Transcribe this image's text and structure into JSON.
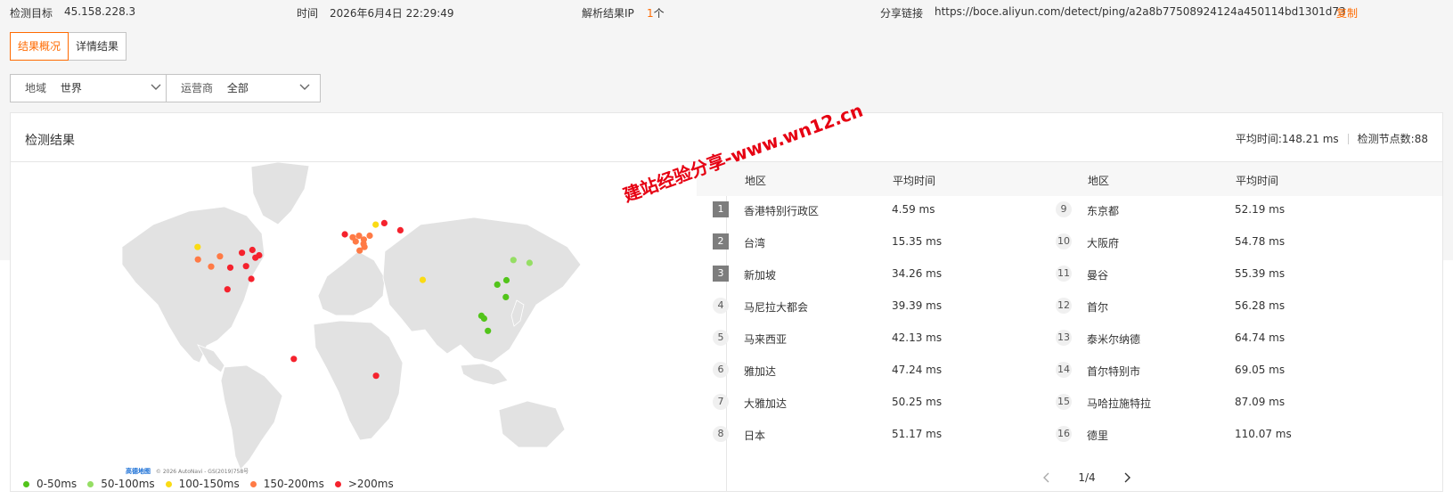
{
  "infobar": {
    "target_label": "检测目标",
    "target_value": "45.158.228.3",
    "time_label": "时间",
    "time_value": "2026年6月4日 22:29:49",
    "resolve_label": "解析结果IP",
    "resolve_count": "1",
    "resolve_unit": "个",
    "share_label": "分享链接",
    "share_url": "https://boce.aliyun.com/detect/ping/a2a8b77508924124a450114bd1301d73",
    "copy_label": "复制"
  },
  "tabs": [
    {
      "label": "结果概况",
      "active": true
    },
    {
      "label": "详情结果",
      "active": false
    }
  ],
  "filters": {
    "region_label": "地域",
    "region_value": "世界",
    "isp_label": "运营商",
    "isp_value": "全部"
  },
  "panel": {
    "title": "检测结果",
    "avg_time": "平均时间:148.21 ms",
    "node_count": "检测节点数:88"
  },
  "table": {
    "col_region": "地区",
    "col_avg": "平均时间",
    "left_rows": [
      {
        "rank": "1",
        "region": "香港特别行政区",
        "avg": "4.59 ms"
      },
      {
        "rank": "2",
        "region": "台湾",
        "avg": "15.35 ms"
      },
      {
        "rank": "3",
        "region": "新加坡",
        "avg": "34.26 ms"
      },
      {
        "rank": "4",
        "region": "马尼拉大都会",
        "avg": "39.39 ms"
      },
      {
        "rank": "5",
        "region": "马来西亚",
        "avg": "42.13 ms"
      },
      {
        "rank": "6",
        "region": "雅加达",
        "avg": "47.24 ms"
      },
      {
        "rank": "7",
        "region": "大雅加达",
        "avg": "50.25 ms"
      },
      {
        "rank": "8",
        "region": "日本",
        "avg": "51.17 ms"
      }
    ],
    "right_rows": [
      {
        "rank": "9",
        "region": "东京都",
        "avg": "52.19 ms"
      },
      {
        "rank": "10",
        "region": "大阪府",
        "avg": "54.78 ms"
      },
      {
        "rank": "11",
        "region": "曼谷",
        "avg": "55.39 ms"
      },
      {
        "rank": "12",
        "region": "首尔",
        "avg": "56.28 ms"
      },
      {
        "rank": "13",
        "region": "泰米尔纳德",
        "avg": "64.74 ms"
      },
      {
        "rank": "14",
        "region": "首尔特别市",
        "avg": "69.05 ms"
      },
      {
        "rank": "15",
        "region": "马哈拉施特拉",
        "avg": "87.09 ms"
      },
      {
        "rank": "16",
        "region": "德里",
        "avg": "110.07 ms"
      }
    ]
  },
  "pager": {
    "text": "1/4"
  },
  "legend": [
    {
      "label": "0-50ms",
      "color": "#52c41a"
    },
    {
      "label": "50-100ms",
      "color": "#95de64"
    },
    {
      "label": "100-150ms",
      "color": "#fadb14"
    },
    {
      "label": "150-200ms",
      "color": "#ff7a45"
    },
    {
      "label": ">200ms",
      "color": "#f5222d"
    }
  ],
  "map": {
    "attribution_brand": "高德地图",
    "attribution_text": "© 2026 AutoNavi - GS(2019)758号",
    "markers": [
      {
        "lat": 22.3,
        "lon": 114.2,
        "color": "#52c41a"
      },
      {
        "lat": 25.0,
        "lon": 121.5,
        "color": "#52c41a"
      },
      {
        "lat": 1.35,
        "lon": 103.8,
        "color": "#52c41a"
      },
      {
        "lat": 14.6,
        "lon": 121.0,
        "color": "#52c41a"
      },
      {
        "lat": 3.1,
        "lon": 101.7,
        "color": "#52c41a"
      },
      {
        "lat": -6.2,
        "lon": 106.8,
        "color": "#52c41a"
      },
      {
        "lat": 35.7,
        "lon": 139.7,
        "color": "#95de64"
      },
      {
        "lat": 37.5,
        "lon": 127.0,
        "color": "#95de64"
      },
      {
        "lat": 25.2,
        "lon": 55.3,
        "color": "#fadb14"
      },
      {
        "lat": 59.3,
        "lon": 18.1,
        "color": "#fadb14"
      },
      {
        "lat": 45.5,
        "lon": -122.7,
        "color": "#fadb14"
      },
      {
        "lat": 37.8,
        "lon": -122.4,
        "color": "#ff7a45"
      },
      {
        "lat": 33.4,
        "lon": -112.0,
        "color": "#ff7a45"
      },
      {
        "lat": 39.7,
        "lon": -105.0,
        "color": "#ff7a45"
      },
      {
        "lat": 51.5,
        "lon": -0.1,
        "color": "#ff7a45"
      },
      {
        "lat": 48.9,
        "lon": 2.3,
        "color": "#ff7a45"
      },
      {
        "lat": 52.4,
        "lon": 4.9,
        "color": "#ff7a45"
      },
      {
        "lat": 50.1,
        "lon": 8.7,
        "color": "#ff7a45"
      },
      {
        "lat": 52.5,
        "lon": 13.4,
        "color": "#ff7a45"
      },
      {
        "lat": 45.5,
        "lon": 9.2,
        "color": "#ff7a45"
      },
      {
        "lat": 43.3,
        "lon": 5.4,
        "color": "#ff7a45"
      },
      {
        "lat": 47.4,
        "lon": 8.5,
        "color": "#ff7a45"
      },
      {
        "lat": 40.4,
        "lon": -74.0,
        "color": "#f5222d"
      },
      {
        "lat": 41.9,
        "lon": -87.6,
        "color": "#f5222d"
      },
      {
        "lat": 38.9,
        "lon": -77.0,
        "color": "#f5222d"
      },
      {
        "lat": 33.7,
        "lon": -84.4,
        "color": "#f5222d"
      },
      {
        "lat": 32.8,
        "lon": -96.8,
        "color": "#f5222d"
      },
      {
        "lat": 25.8,
        "lon": -80.2,
        "color": "#f5222d"
      },
      {
        "lat": 43.7,
        "lon": -79.4,
        "color": "#f5222d"
      },
      {
        "lat": 19.4,
        "lon": -99.1,
        "color": "#f5222d"
      },
      {
        "lat": -23.5,
        "lon": -46.6,
        "color": "#f5222d"
      },
      {
        "lat": -33.9,
        "lon": 18.4,
        "color": "#f5222d"
      },
      {
        "lat": 55.8,
        "lon": 37.6,
        "color": "#f5222d"
      },
      {
        "lat": 60.2,
        "lon": 24.9,
        "color": "#f5222d"
      },
      {
        "lat": 53.3,
        "lon": -6.3,
        "color": "#f5222d"
      }
    ]
  },
  "watermark": "建站经验分享-www.wn12.cn"
}
